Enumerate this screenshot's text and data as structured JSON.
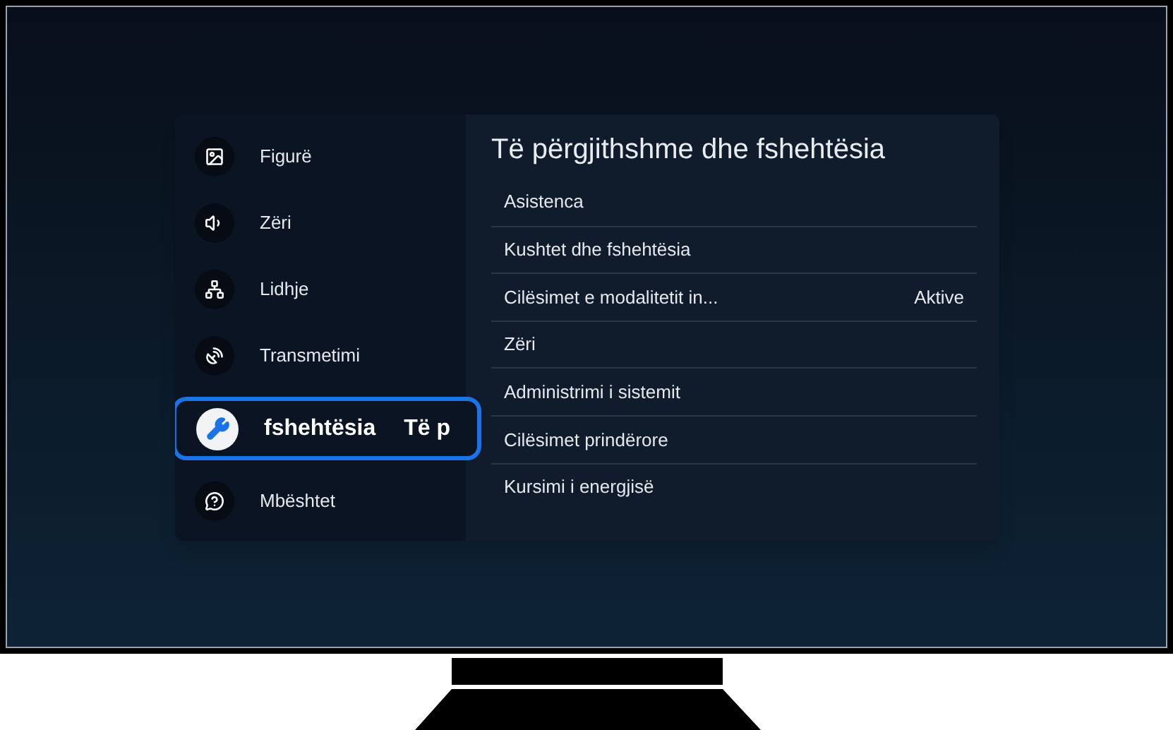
{
  "sidebar": {
    "items": [
      {
        "label": "Figurë",
        "selected": false
      },
      {
        "label": "Zëri",
        "selected": false
      },
      {
        "label": "Lidhje",
        "selected": false
      },
      {
        "label": "Transmetimi",
        "selected": false
      },
      {
        "label": "fshehtësia",
        "marquee_next": "Të p",
        "selected": true
      },
      {
        "label": "Mbështet",
        "selected": false
      }
    ]
  },
  "panel": {
    "title": "Të përgjithshme dhe fshehtësia",
    "rows": [
      {
        "label": "Asistenca"
      },
      {
        "label": "Kushtet dhe fshehtësia"
      },
      {
        "label": "Cilësimet e modalitetit in...",
        "value": "Aktive"
      },
      {
        "label": "Zëri"
      },
      {
        "label": "Administrimi i sistemit"
      },
      {
        "label": "Cilësimet prindërore"
      },
      {
        "label": "Kursimi i energjisë"
      }
    ]
  }
}
